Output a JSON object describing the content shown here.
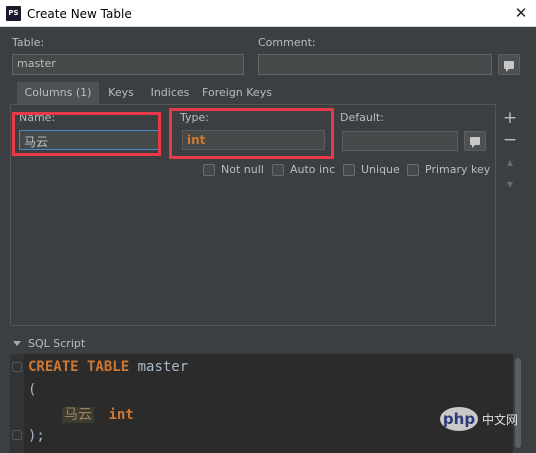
{
  "window": {
    "title": "Create New Table",
    "app_icon": "PS",
    "close_glyph": "✕"
  },
  "table": {
    "label": "Table:",
    "value": "master"
  },
  "comment": {
    "label": "Comment:",
    "value": ""
  },
  "tabs": [
    {
      "label": "Columns (1)",
      "active": true
    },
    {
      "label": "Keys",
      "active": false
    },
    {
      "label": "Indices",
      "active": false
    },
    {
      "label": "Foreign Keys",
      "active": false
    }
  ],
  "column": {
    "name_label": "Name:",
    "name_value": "马云",
    "type_label": "Type:",
    "type_value": "int",
    "default_label": "Default:",
    "default_value": ""
  },
  "checkboxes": [
    {
      "label": "Not null",
      "checked": false
    },
    {
      "label": "Auto inc",
      "checked": false
    },
    {
      "label": "Unique",
      "checked": false
    },
    {
      "label": "Primary key",
      "checked": false
    }
  ],
  "side_buttons": {
    "add": "+",
    "remove": "−",
    "up": "▲",
    "down": "▼"
  },
  "sql": {
    "label": "SQL Script",
    "line1_kw": "CREATE TABLE",
    "line1_name": "master",
    "line2": "(",
    "line3_col": "马云",
    "line3_type": "int",
    "line4": ");"
  },
  "watermark": {
    "text": "php",
    "suffix": "中文网"
  },
  "colors": {
    "highlight_red": "#e8384a",
    "keyword": "#cc7832",
    "focus_blue": "#4a88c7"
  }
}
